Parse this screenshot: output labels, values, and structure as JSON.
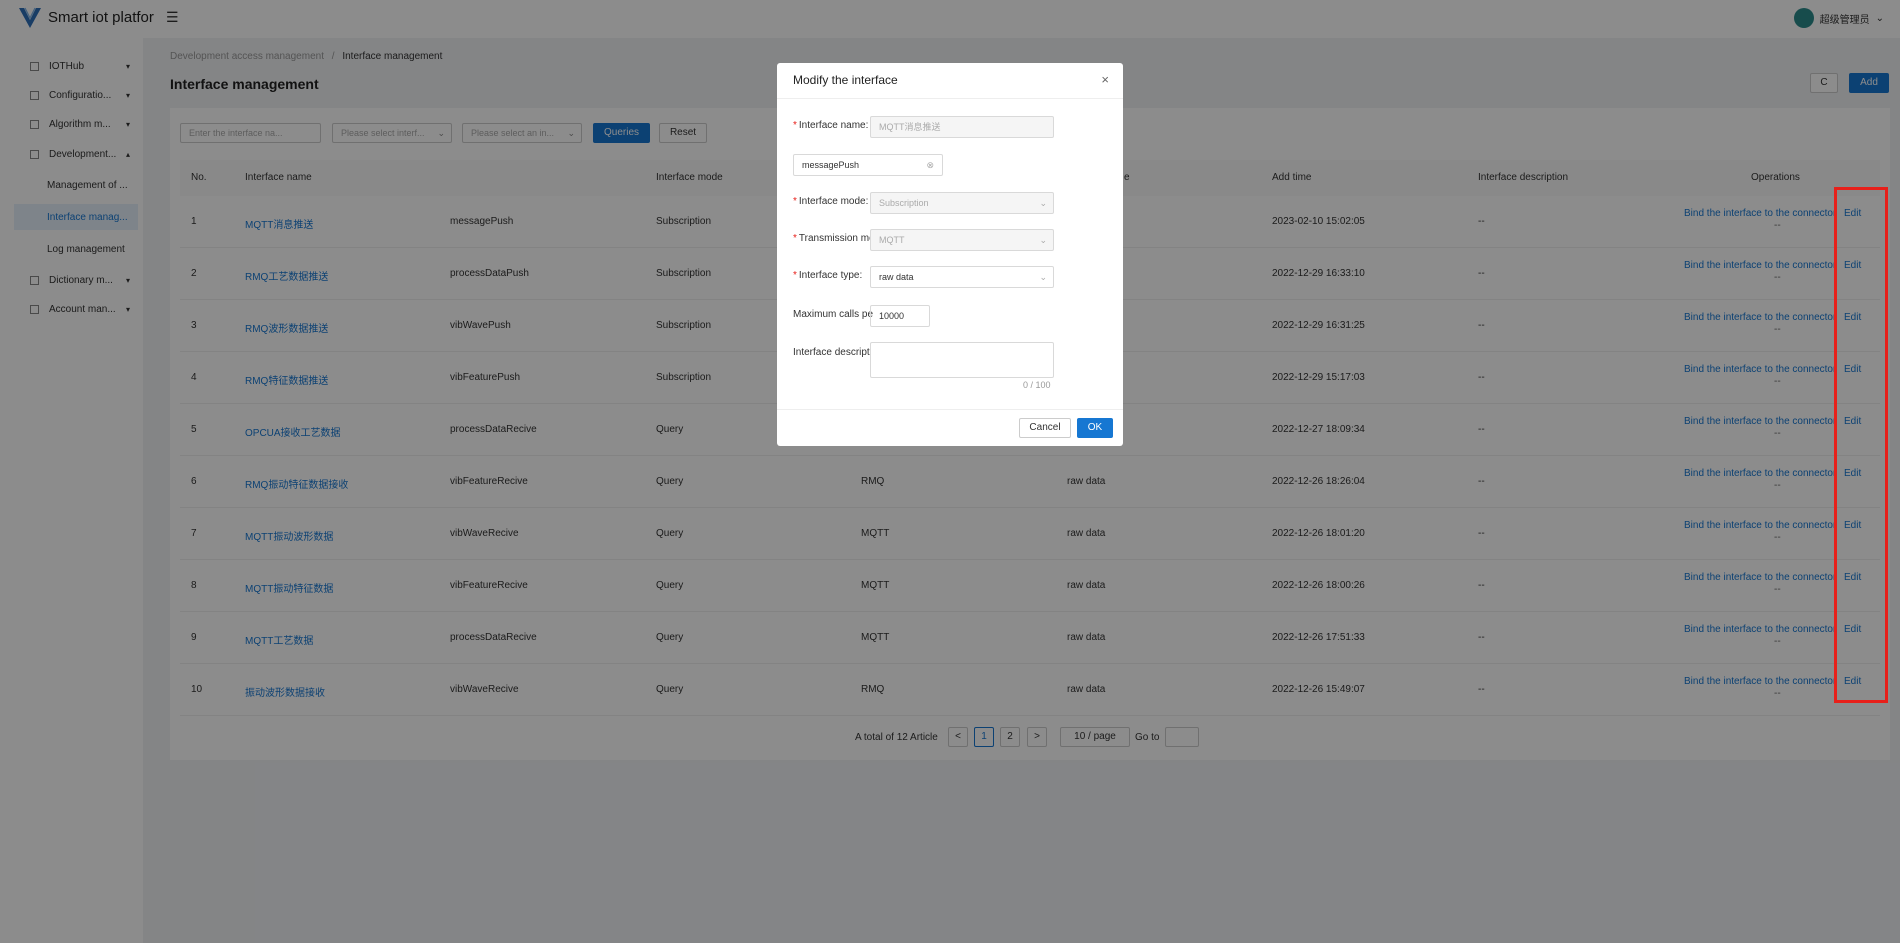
{
  "header": {
    "title": "Smart iot platfor",
    "user": "超级管理员"
  },
  "sidebar": {
    "items": [
      {
        "label": "IOTHub"
      },
      {
        "label": "Configuratio..."
      },
      {
        "label": "Algorithm m..."
      },
      {
        "label": "Development..."
      },
      {
        "label": "Dictionary m..."
      },
      {
        "label": "Account man..."
      }
    ],
    "subitems": [
      {
        "label": "Management of ..."
      },
      {
        "label": "Interface manag..."
      },
      {
        "label": "Log management"
      }
    ]
  },
  "breadcrumb": {
    "parent": "Development access management",
    "sep": "/",
    "current": "Interface management"
  },
  "page": {
    "title": "Interface management",
    "refresh": "C",
    "add": "Add"
  },
  "filters": {
    "name_placeholder": "Enter the interface na...",
    "type_placeholder": "Please select interf...",
    "mode_placeholder": "Please select an in...",
    "query": "Queries",
    "reset": "Reset"
  },
  "table": {
    "headers": [
      "No.",
      "Interface name",
      "Interface mode",
      "e",
      "Add time",
      "Interface description",
      "Operations"
    ],
    "bind_label": "Bind the interface to the connector",
    "edit_label": "Edit",
    "more_label": "--",
    "rows": [
      {
        "no": "1",
        "name": "MQTT消息推送",
        "code": "messagePush",
        "mode": "Subscription",
        "transport": "",
        "type": "",
        "time": "2023-02-10 15:02:05",
        "desc": "--"
      },
      {
        "no": "2",
        "name": "RMQ工艺数据推送",
        "code": "processDataPush",
        "mode": "Subscription",
        "transport": "",
        "type": "",
        "time": "2022-12-29 16:33:10",
        "desc": "--"
      },
      {
        "no": "3",
        "name": "RMQ波形数据推送",
        "code": "vibWavePush",
        "mode": "Subscription",
        "transport": "",
        "type": "",
        "time": "2022-12-29 16:31:25",
        "desc": "--"
      },
      {
        "no": "4",
        "name": "RMQ特征数据推送",
        "code": "vibFeaturePush",
        "mode": "Subscription",
        "transport": "",
        "type": "",
        "time": "2022-12-29 15:17:03",
        "desc": "--"
      },
      {
        "no": "5",
        "name": "OPCUA接收工艺数据",
        "code": "processDataRecive",
        "mode": "Query",
        "transport": "",
        "type": "",
        "time": "2022-12-27 18:09:34",
        "desc": "--"
      },
      {
        "no": "6",
        "name": "RMQ振动特征数据接收",
        "code": "vibFeatureRecive",
        "mode": "Query",
        "transport": "RMQ",
        "type": "raw data",
        "time": "2022-12-26 18:26:04",
        "desc": "--"
      },
      {
        "no": "7",
        "name": "MQTT振动波形数据",
        "code": "vibWaveRecive",
        "mode": "Query",
        "transport": "MQTT",
        "type": "raw data",
        "time": "2022-12-26 18:01:20",
        "desc": "--"
      },
      {
        "no": "8",
        "name": "MQTT振动特征数据",
        "code": "vibFeatureRecive",
        "mode": "Query",
        "transport": "MQTT",
        "type": "raw data",
        "time": "2022-12-26 18:00:26",
        "desc": "--"
      },
      {
        "no": "9",
        "name": "MQTT工艺数据",
        "code": "processDataRecive",
        "mode": "Query",
        "transport": "MQTT",
        "type": "raw data",
        "time": "2022-12-26 17:51:33",
        "desc": "--"
      },
      {
        "no": "10",
        "name": "振动波形数据接收",
        "code": "vibWaveRecive",
        "mode": "Query",
        "transport": "RMQ",
        "type": "raw data",
        "time": "2022-12-26 15:49:07",
        "desc": "--"
      }
    ]
  },
  "pagination": {
    "total": "A total of 12 Article",
    "prev": "<",
    "pages": [
      "1",
      "2"
    ],
    "next": ">",
    "size": "10 / page",
    "goto": "Go to"
  },
  "modal": {
    "title": "Modify the interface",
    "close": "×",
    "name_label": "Interface name:",
    "name_value": "MQTT消息推送",
    "code_value": "messagePush",
    "mode_label": "Interface mode:",
    "mode_value": "Subscription",
    "transport_label": "Transmission mo",
    "transport_value": "MQTT",
    "type_label": "Interface type:",
    "type_value": "raw data",
    "calls_label": "Maximum calls pe",
    "calls_value": "10000",
    "desc_label": "Interface descript",
    "desc_count": "0 / 100",
    "cancel": "Cancel",
    "ok": "OK"
  },
  "colors": {
    "primary": "#1677d2",
    "highlight": "#e8201a"
  }
}
